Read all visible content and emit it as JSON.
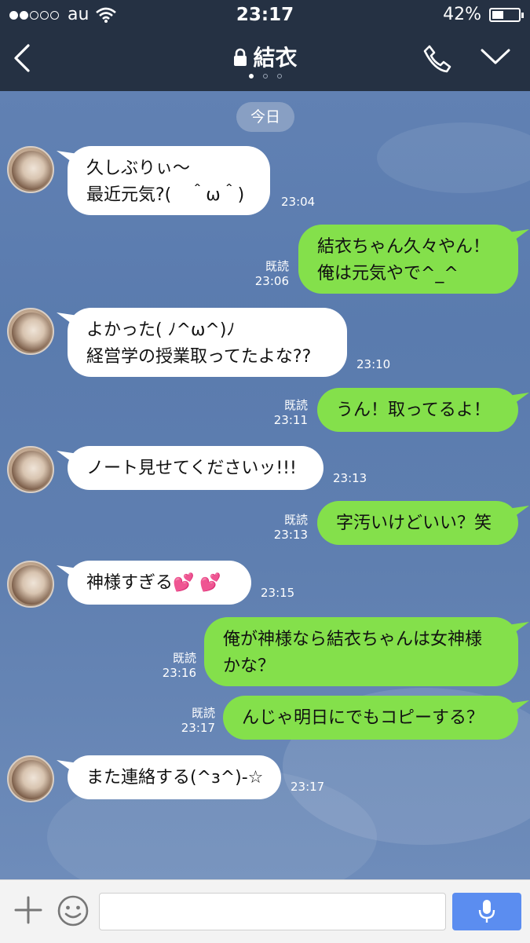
{
  "status_bar": {
    "carrier": "au",
    "time": "23:17",
    "battery": "42%",
    "signal_bars_filled": 2,
    "signal_bars_total": 5
  },
  "header": {
    "title": "結衣",
    "page_dots": 3,
    "active_dot": 0
  },
  "date_separator": "今日",
  "messages": [
    {
      "side": "in",
      "text_lines": [
        "久しぶりぃ〜",
        "最近元気?(　＾ω＾)"
      ],
      "time": "23:04"
    },
    {
      "side": "out",
      "text_lines": [
        "結衣ちゃん久々やん！",
        "俺は元気やで^_^"
      ],
      "read": "既読",
      "time": "23:06"
    },
    {
      "side": "in",
      "text_lines": [
        "よかった( ﾉ^ω^)ﾉ",
        "経営学の授業取ってたよな??"
      ],
      "time": "23:10"
    },
    {
      "side": "out",
      "text_lines": [
        "うん！取ってるよ！"
      ],
      "read": "既読",
      "time": "23:11"
    },
    {
      "side": "in",
      "text_lines": [
        "ノート見せてくださいッ!!!"
      ],
      "time": "23:13"
    },
    {
      "side": "out",
      "text_lines": [
        "字汚いけどいい？笑"
      ],
      "read": "既読",
      "time": "23:13"
    },
    {
      "side": "in",
      "text_lines": [
        "神様すぎる💕 💕"
      ],
      "time": "23:15"
    },
    {
      "side": "out",
      "text_lines": [
        "俺が神様なら結衣ちゃんは女神様",
        "かな？"
      ],
      "read": "既読",
      "time": "23:16"
    },
    {
      "side": "out",
      "text_lines": [
        "んじゃ明日にでもコピーする？"
      ],
      "read": "既読",
      "time": "23:17"
    },
    {
      "side": "in",
      "text_lines": [
        "また連絡する(^з^)-☆"
      ],
      "time": "23:17"
    }
  ],
  "input_bar": {
    "placeholder": "",
    "plus_icon": "plus-icon",
    "emoji_icon": "smiley-icon",
    "mic_icon": "microphone-icon",
    "mic_color": "#5b8df0"
  },
  "colors": {
    "header_bg": "#253143",
    "outgoing_bubble": "#84e04b",
    "incoming_bubble": "#ffffff",
    "chat_bg": "#5b79a6"
  }
}
